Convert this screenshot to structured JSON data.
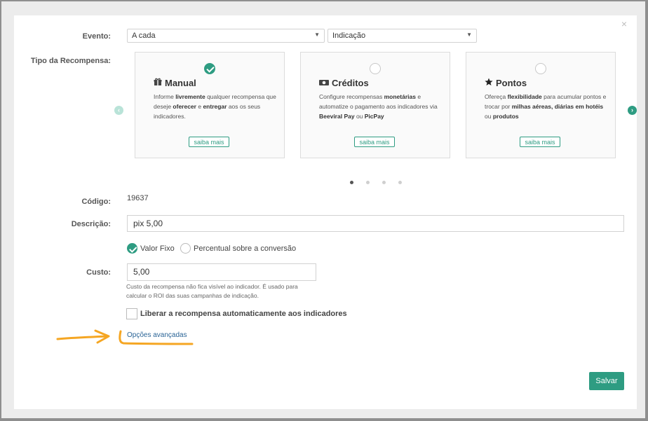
{
  "modal": {
    "close_glyph": "×"
  },
  "evento": {
    "label": "Evento:",
    "select1_value": "A cada",
    "select2_value": "Indicação"
  },
  "tipo": {
    "label": "Tipo da Recompensa:",
    "cards": [
      {
        "name": "Manual",
        "icon": "gift-icon",
        "selected": true,
        "desc_parts": [
          "Informe ",
          "livremente",
          " qualquer recompensa que deseje ",
          "oferecer",
          " e ",
          "entregar",
          " aos os seus indicadores."
        ],
        "more": "saiba mais"
      },
      {
        "name": "Créditos",
        "icon": "money-icon",
        "selected": false,
        "desc_parts": [
          "Configure recompensas ",
          "monetárias",
          " e automatize o pagamento aos indicadores via ",
          "Beeviral Pay",
          " ou ",
          "PicPay"
        ],
        "more": "saiba mais"
      },
      {
        "name": "Pontos",
        "icon": "star-icon",
        "selected": false,
        "desc_parts": [
          "Ofereça ",
          "flexibilidade",
          " para acumular pontos e trocar por ",
          "milhas aéreas, diárias em hotéis",
          " ou ",
          "produtos"
        ],
        "more": "saiba mais"
      }
    ],
    "carousel_pages": 4,
    "carousel_active_page": 1
  },
  "codigo": {
    "label": "Código:",
    "value": "19637"
  },
  "descricao": {
    "label": "Descrição:",
    "value": "pix 5,00"
  },
  "tipo_valor": {
    "option1": "Valor Fixo",
    "option2": "Percentual sobre a conversão",
    "selected": "Valor Fixo"
  },
  "custo": {
    "label": "Custo:",
    "value": "5,00",
    "help": "Custo da recompensa não fica visível ao indicador. É usado para calcular o ROI das suas campanhas de indicação."
  },
  "liberar": {
    "label": "Liberar a recompensa automaticamente aos indicadores",
    "checked": false
  },
  "advanced_link": "Opções avançadas",
  "save_label": "Salvar",
  "colors": {
    "accent": "#2e9c82",
    "link": "#2a6496",
    "annotation": "#f5a623"
  }
}
